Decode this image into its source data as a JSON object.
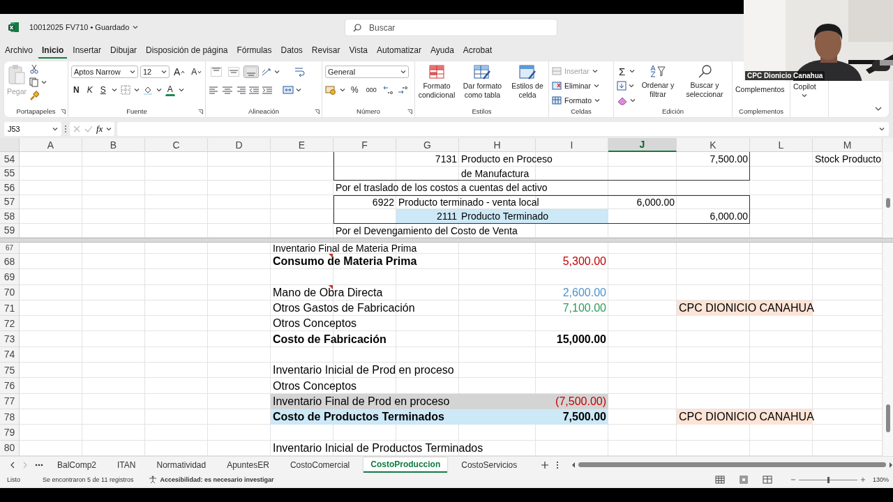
{
  "title_bar": {
    "document": "10012025 FV710 • Guardado",
    "search_placeholder": "Buscar"
  },
  "menu_tabs": [
    {
      "label": "Archivo",
      "selected": false
    },
    {
      "label": "Inicio",
      "selected": true
    },
    {
      "label": "Insertar",
      "selected": false
    },
    {
      "label": "Dibujar",
      "selected": false
    },
    {
      "label": "Disposición de página",
      "selected": false
    },
    {
      "label": "Fórmulas",
      "selected": false
    },
    {
      "label": "Datos",
      "selected": false
    },
    {
      "label": "Revisar",
      "selected": false
    },
    {
      "label": "Vista",
      "selected": false
    },
    {
      "label": "Automatizar",
      "selected": false
    },
    {
      "label": "Ayuda",
      "selected": false
    },
    {
      "label": "Acrobat",
      "selected": false
    }
  ],
  "ribbon": {
    "clipboard": {
      "label": "Portapapeles",
      "paste": {
        "label": "Pegar",
        "disabled": true
      }
    },
    "font": {
      "label": "Fuente",
      "font_name": "Aptos Narrow",
      "font_size": "12",
      "grow": "A",
      "shrink": "A",
      "bold": "N",
      "italic": "K",
      "underline": "S",
      "font_color": "A"
    },
    "alignment": {
      "label": "Alineación",
      "vertical": [
        {
          "selected": false
        },
        {
          "selected": false
        },
        {
          "selected": true
        }
      ]
    },
    "number": {
      "label": "Número",
      "format": "General",
      "percent": "%",
      "thousands": "000"
    },
    "styles": {
      "label": "Estilos",
      "buttons": [
        "Formato condicional",
        "Dar formato como tabla",
        "Estilos de celda"
      ]
    },
    "cells": {
      "label": "Celdas",
      "buttons": [
        {
          "label": "Insertar",
          "disabled": true
        },
        {
          "label": "Eliminar",
          "disabled": false
        },
        {
          "label": "Formato",
          "disabled": false
        }
      ]
    },
    "editing": {
      "label": "Edición",
      "sum": "Σ",
      "buttons": [
        "Ordenar y filtrar",
        "Buscar y seleccionar"
      ]
    },
    "addins": {
      "label": "Complementos",
      "button": "Complementos"
    },
    "copilot": {
      "button": "Copilot"
    }
  },
  "formula_bar": {
    "name_box": "J53",
    "function_label": "fx"
  },
  "sheet": {
    "columns": [
      {
        "label": "A",
        "selected": false
      },
      {
        "label": "B",
        "selected": false
      },
      {
        "label": "C",
        "selected": false
      },
      {
        "label": "D",
        "selected": false
      },
      {
        "label": "E",
        "selected": false
      },
      {
        "label": "F",
        "selected": false
      },
      {
        "label": "G",
        "selected": false
      },
      {
        "label": "H",
        "selected": false
      },
      {
        "label": "I",
        "selected": false
      },
      {
        "label": "J",
        "selected": true
      },
      {
        "label": "K",
        "selected": false
      },
      {
        "label": "L",
        "selected": false
      },
      {
        "label": "M",
        "selected": false
      }
    ],
    "panes": [
      {
        "rows": [
          {
            "number": "54",
            "cells": {
              "F": {
                "left": true
              },
              "G": {
                "text": "7131",
                "kind": "number"
              },
              "H": {
                "text": "Producto en Proceso",
                "kind": "label"
              },
              "K": {
                "text": "7,500.00",
                "kind": "number",
                "right": true
              },
              "M": {
                "text": "Stock Producto",
                "kind": "label"
              }
            }
          },
          {
            "number": "55",
            "cells": {
              "F": {
                "left": true,
                "bottom": true
              },
              "G": {
                "bottom": true
              },
              "H": {
                "text": "de Manufactura",
                "kind": "label",
                "bottom": true
              },
              "I": {
                "bottom": true
              },
              "J": {
                "bottom": true
              },
              "K": {
                "right": true,
                "bottom": true
              }
            }
          },
          {
            "number": "56",
            "cells": {
              "F": {
                "text": "Por el traslado de los costos a cuentas del activo",
                "kind": "label"
              }
            }
          },
          {
            "number": "57",
            "cells": {
              "F": {
                "text": "6922",
                "kind": "number",
                "left": true,
                "top": true
              },
              "G": {
                "text": "Producto terminado - venta local",
                "kind": "label",
                "top": true
              },
              "H": {
                "top": true
              },
              "I": {
                "top": true
              },
              "J": {
                "text": "6,000.00",
                "kind": "number",
                "top": true
              },
              "K": {
                "top": true,
                "right": true
              }
            }
          },
          {
            "number": "58",
            "cells": {
              "F": {
                "left": true,
                "bottom": true
              },
              "G": {
                "text": "2111",
                "kind": "number",
                "color": "#cde8f6",
                "bottom": true
              },
              "H": {
                "text": "Producto Terminado",
                "kind": "label",
                "color": "#cde8f6",
                "bottom": true
              },
              "I": {
                "color": "#cde8f6",
                "bottom": true
              },
              "J": {
                "bottom": true
              },
              "K": {
                "text": "6,000.00",
                "kind": "number",
                "right": true,
                "bottom": true
              }
            }
          },
          {
            "number": "59",
            "cells": {
              "F": {
                "text": "Por el Devengamiento del Costo de Venta",
                "kind": "label"
              }
            }
          }
        ]
      },
      {
        "rows": [
          {
            "number": "67",
            "cells": {
              "E": {
                "text": "Inventario Final de Materia Prima",
                "kind": "label"
              }
            }
          },
          {
            "number": "68",
            "cells": {
              "E": {
                "text": "Consumo de Materia Prima",
                "kind": "label",
                "bold": true,
                "comment": true
              },
              "I": {
                "text": "5,300.00",
                "kind": "number",
                "font": {
                  "color": "#c00000"
                }
              }
            }
          },
          {
            "number": "69",
            "cells": {}
          },
          {
            "number": "70",
            "cells": {
              "E": {
                "text": "Mano de Obra Directa",
                "kind": "label",
                "comment": true
              },
              "I": {
                "text": "2,600.00",
                "kind": "number",
                "font": {
                  "color": "#4a94cf"
                }
              }
            }
          },
          {
            "number": "71",
            "cells": {
              "E": {
                "text": "Otros Gastos de Fabricación",
                "kind": "label"
              },
              "I": {
                "text": "7,100.00",
                "kind": "number",
                "font": {
                  "color": "#2e9a5c"
                }
              },
              "K": {
                "text": "CPC DIONICIO CANAHUA",
                "kind": "label",
                "color": "#fce4d6"
              },
              "L": {
                "color": "#fce4d6"
              }
            }
          },
          {
            "number": "72",
            "cells": {
              "E": {
                "text": "Otros Conceptos",
                "kind": "label"
              }
            }
          },
          {
            "number": "73",
            "cells": {
              "E": {
                "text": "Costo de Fabricación",
                "kind": "label",
                "bold": true
              },
              "I": {
                "text": "15,000.00",
                "kind": "number",
                "bold": true
              }
            }
          },
          {
            "number": "74",
            "cells": {}
          },
          {
            "number": "75",
            "cells": {
              "E": {
                "text": "Inventario Inicial de Prod en proceso",
                "kind": "label"
              }
            }
          },
          {
            "number": "76",
            "cells": {
              "E": {
                "text": "Otros Conceptos",
                "kind": "label"
              }
            }
          },
          {
            "number": "77",
            "cells": {
              "E": {
                "text": "Inventario Final de Prod en proceso",
                "kind": "label",
                "color": "#d4d4d4"
              },
              "F": {
                "color": "#d4d4d4"
              },
              "G": {
                "color": "#d4d4d4"
              },
              "H": {
                "color": "#d4d4d4"
              },
              "I": {
                "text": "(7,500.00)",
                "kind": "number",
                "font": {
                  "color": "#c00000"
                },
                "color": "#d4d4d4"
              }
            }
          },
          {
            "number": "78",
            "cells": {
              "E": {
                "text": "Costo de Productos Terminados",
                "kind": "label",
                "bold": true,
                "color": "#cde8f6"
              },
              "F": {
                "color": "#cde8f6"
              },
              "G": {
                "color": "#cde8f6"
              },
              "H": {
                "color": "#cde8f6"
              },
              "I": {
                "text": "7,500.00",
                "kind": "number",
                "bold": true,
                "color": "#cde8f6"
              },
              "K": {
                "text": "CPC DIONICIO CANAHUA",
                "kind": "label",
                "color": "#fce4d6"
              },
              "L": {
                "color": "#fce4d6"
              }
            }
          },
          {
            "number": "79",
            "cells": {}
          },
          {
            "number": "80",
            "cells": {
              "E": {
                "text": "Inventario Inicial de Productos Terminados",
                "kind": "label"
              }
            }
          }
        ]
      }
    ]
  },
  "sheet_tabs": [
    {
      "label": "BalComp2",
      "selected": false
    },
    {
      "label": "ITAN",
      "selected": false
    },
    {
      "label": "Normatividad",
      "selected": false
    },
    {
      "label": "ApuntesER",
      "selected": false
    },
    {
      "label": "CostoComercial",
      "selected": false
    },
    {
      "label": "CostoProduccion",
      "selected": true
    },
    {
      "label": "CostoServicios",
      "selected": false
    }
  ],
  "status_bar": {
    "ready": "Listo",
    "found": "Se encontraron 5 de 11 registros",
    "accessibility": "Accesibilidad: es necesario investigar",
    "zoom": "130%",
    "zoom_slider": {
      "level": 0.5
    }
  },
  "video": {
    "kind": "picture",
    "name": "CPC Dionicio Canahua"
  }
}
